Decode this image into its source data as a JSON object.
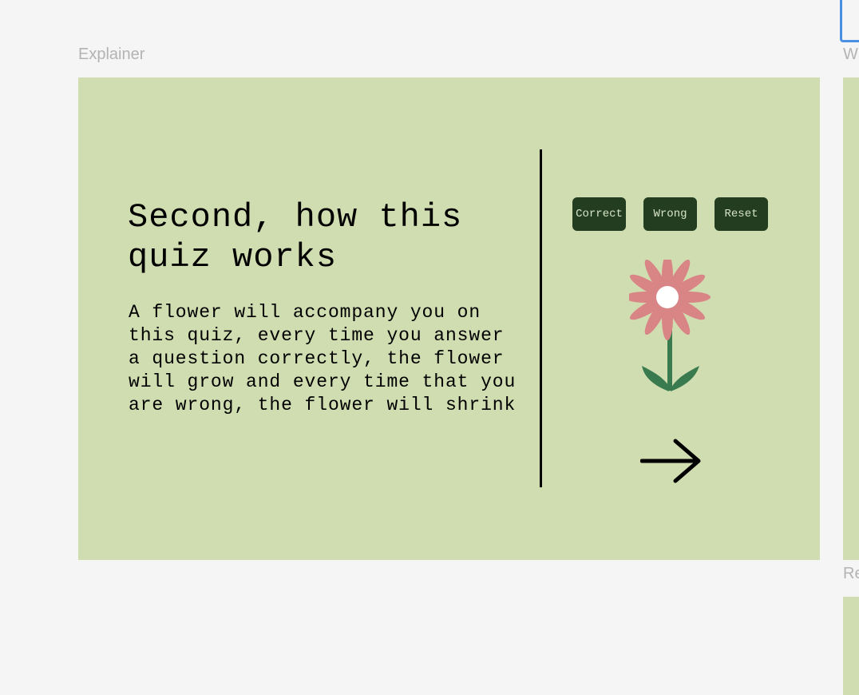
{
  "frames": {
    "main_label": "Explainer",
    "side_label_1": "W",
    "side_label_2": "Re"
  },
  "explainer": {
    "heading": "Second, how this quiz works",
    "body": "A flower will accompany you on this quiz, every time you answer a question correctly, the flower will grow and every time that you are wrong, the flower will shrink"
  },
  "controls": {
    "correct_label": "Correct",
    "wrong_label": "Wrong",
    "reset_label": "Reset"
  },
  "icons": {
    "flower": "flower-icon",
    "next": "arrow-right-icon"
  },
  "colors": {
    "canvas_bg": "#f5f5f5",
    "frame_bg": "#d0ddb0",
    "button_bg": "#223d1f",
    "button_text": "#d8e4c6",
    "petal": "#d98585",
    "stem": "#3a7a4f",
    "selection": "#4a90e2",
    "label": "#b3b3b3"
  }
}
